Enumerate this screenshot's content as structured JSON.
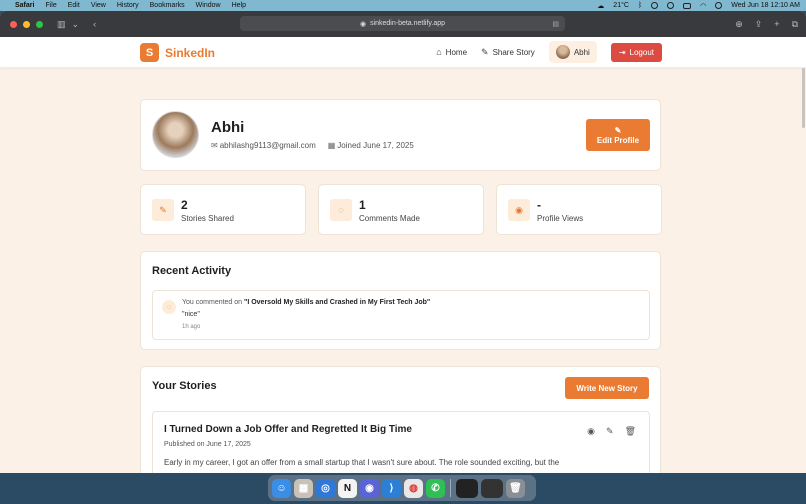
{
  "menubar": {
    "app_name": "Safari",
    "items": [
      "File",
      "Edit",
      "View",
      "History",
      "Bookmarks",
      "Window",
      "Help"
    ],
    "temperature": "21°C",
    "datetime": "Wed Jun 18  12:10 AM"
  },
  "browser": {
    "url": "sinkedin-beta.netlify.app"
  },
  "nav": {
    "logo_letter": "S",
    "logo_text": "SinkedIn",
    "home_label": "Home",
    "share_label": "Share Story",
    "user_label": "Abhi",
    "logout_label": "Logout"
  },
  "profile": {
    "name": "Abhi",
    "email": "abhilashg9113@gmail.com",
    "joined": "Joined June 17, 2025",
    "edit_label": "Edit Profile"
  },
  "stats": [
    {
      "value": "2",
      "label": "Stories Shared",
      "icon": "pencil-icon"
    },
    {
      "value": "1",
      "label": "Comments Made",
      "icon": "comment-icon"
    },
    {
      "value": "-",
      "label": "Profile Views",
      "icon": "eye-icon"
    }
  ],
  "activity": {
    "title": "Recent Activity",
    "items": [
      {
        "prefix": "You commented on",
        "story": "\"I Oversold My Skills and Crashed in My First Tech Job\"",
        "quote": "\"nice\"",
        "time": "1h ago"
      }
    ]
  },
  "stories": {
    "title": "Your Stories",
    "write_label": "Write New Story",
    "items": [
      {
        "title": "I Turned Down a Job Offer and Regretted It Big Time",
        "date": "Published on June 17, 2025",
        "excerpt": "Early in my career, I got an offer from a small startup that I wasn't sure about. The role sounded exciting, but the"
      }
    ]
  },
  "colors": {
    "accent": "#ea7b32",
    "logout": "#dc4a42",
    "page_bg": "#fbf1e6"
  }
}
